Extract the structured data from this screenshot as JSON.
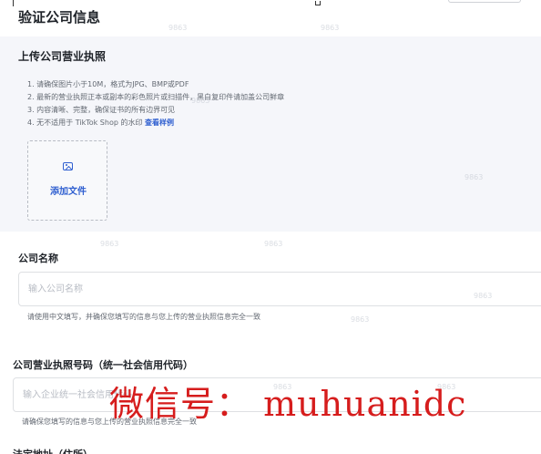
{
  "page": {
    "title": "验证公司信息"
  },
  "upload": {
    "title": "上传公司营业执照",
    "requirements": [
      "1. 请确保图片小于10M，格式为JPG、BMP或PDF",
      "2. 最新的营业执照正本或副本的彩色照片或扫描件，黑白复印件请加盖公司鲜章",
      "3. 内容清晰、完整，确保证书的所有边界可见",
      "4. 无不适用于 TikTok Shop 的水印"
    ],
    "sample_link": "查看样例",
    "add_file_label": "添加文件",
    "icon": "image-icon"
  },
  "company_name": {
    "label": "公司名称",
    "placeholder": "输入公司名称",
    "value": "",
    "hint": "请使用中文填写，并确保您填写的信息与您上传的营业执照信息完全一致"
  },
  "license_number": {
    "label": "公司营业执照号码（统一社会信用代码）",
    "placeholder": "输入企业统一社会信用代码",
    "value": "",
    "hint": "请确保您填写的信息与您上传的营业执照信息完全一致"
  },
  "next_field": {
    "label": "法定地址（住所）"
  },
  "watermark": "9863",
  "overlay": {
    "text": "微信号： muhuanidc",
    "color": "#d61d1d"
  },
  "colors": {
    "accent": "#2f5fd0",
    "section_bg": "#f5f6fa"
  }
}
